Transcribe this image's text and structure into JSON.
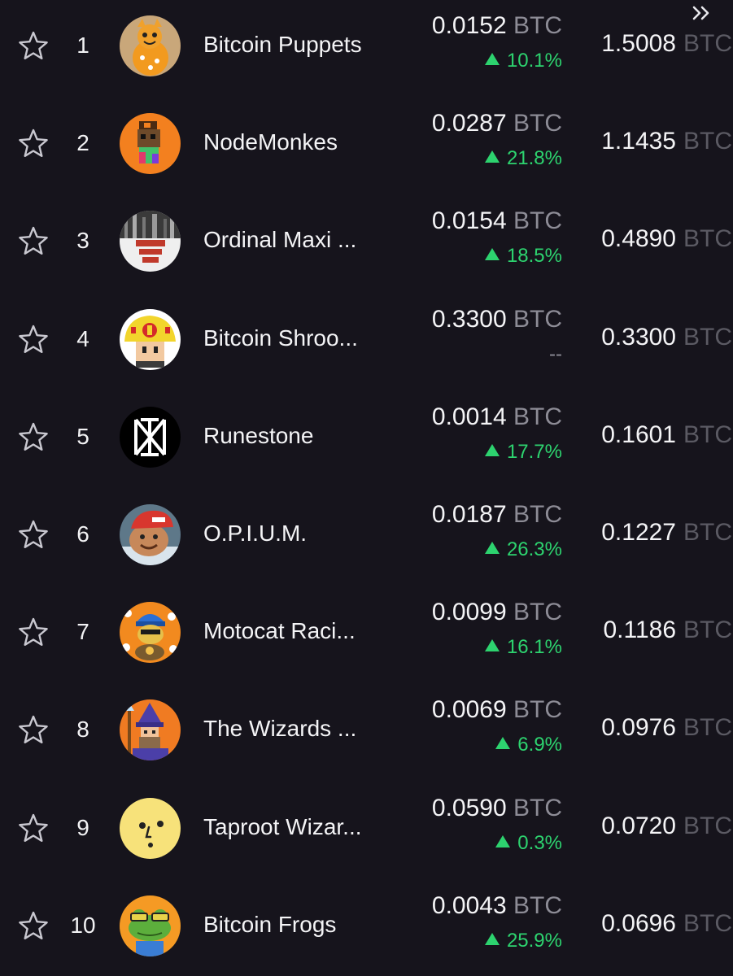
{
  "unit": "BTC",
  "rows": [
    {
      "rank": "1",
      "name": "Bitcoin Puppets",
      "price": "0.0152",
      "change": "10.1%",
      "volume": "1.5008"
    },
    {
      "rank": "2",
      "name": "NodeMonkes",
      "price": "0.0287",
      "change": "21.8%",
      "volume": "1.1435"
    },
    {
      "rank": "3",
      "name": "Ordinal Maxi ...",
      "price": "0.0154",
      "change": "18.5%",
      "volume": "0.4890"
    },
    {
      "rank": "4",
      "name": "Bitcoin Shroo...",
      "price": "0.3300",
      "change": "--",
      "volume": "0.3300"
    },
    {
      "rank": "5",
      "name": "Runestone",
      "price": "0.0014",
      "change": "17.7%",
      "volume": "0.1601"
    },
    {
      "rank": "6",
      "name": "O.P.I.U.M.",
      "price": "0.0187",
      "change": "26.3%",
      "volume": "0.1227"
    },
    {
      "rank": "7",
      "name": "Motocat Raci...",
      "price": "0.0099",
      "change": "16.1%",
      "volume": "0.1186"
    },
    {
      "rank": "8",
      "name": "The Wizards ...",
      "price": "0.0069",
      "change": "6.9%",
      "volume": "0.0976"
    },
    {
      "rank": "9",
      "name": "Taproot Wizar...",
      "price": "0.0590",
      "change": "0.3%",
      "volume": "0.0720"
    },
    {
      "rank": "10",
      "name": "Bitcoin Frogs",
      "price": "0.0043",
      "change": "25.9%",
      "volume": "0.0696"
    }
  ],
  "colors": {
    "background": "#16141c",
    "positive": "#2dd36f",
    "muted": "#8d8c96"
  },
  "icons": {
    "expand": "double-chevron-right-icon",
    "favorite": "star-outline-icon"
  }
}
